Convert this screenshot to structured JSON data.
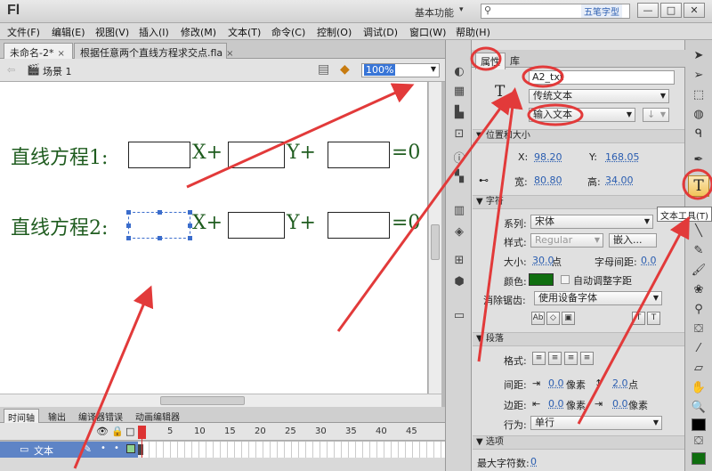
{
  "app": {
    "logo": "Fl",
    "workspace": "基本功能",
    "watermark": "五笔字型"
  },
  "window_controls": {
    "minimize": "—",
    "maximize": "□",
    "close": "✕"
  },
  "menu": [
    "文件(F)",
    "编辑(E)",
    "视图(V)",
    "插入(I)",
    "修改(M)",
    "文本(T)",
    "命令(C)",
    "控制(O)",
    "调试(D)",
    "窗口(W)",
    "帮助(H)"
  ],
  "doc_tabs": [
    "未命名-2*",
    "根据任意两个直线方程求交点.fla"
  ],
  "scene": {
    "label": "场景 1",
    "zoom": "100%"
  },
  "stage": {
    "eq1_label": "直线方程1:",
    "eq2_label": "直线方程2:",
    "x_plus": "X+",
    "y_plus": "Y+",
    "eq_zero": "=0"
  },
  "timeline": {
    "tabs": [
      "时间轴",
      "输出",
      "编译器错误",
      "动画编辑器"
    ],
    "frame_numbers": [
      "1",
      "5",
      "10",
      "15",
      "20",
      "25",
      "30",
      "35",
      "40",
      "45"
    ],
    "layer_name": "文本"
  },
  "properties": {
    "tabs": [
      "属性",
      "库"
    ],
    "instance_name": "A2_txt",
    "text_engine": "传统文本",
    "text_type": "输入文本",
    "section_position": "位置和大小",
    "x_label": "X:",
    "x_value": "98.20",
    "y_label": "Y:",
    "y_value": "168.05",
    "w_label": "宽:",
    "w_value": "80.80",
    "h_label": "高:",
    "h_value": "34.00",
    "section_char": "字符",
    "family_label": "系列:",
    "family_value": "宋体",
    "style_label": "样式:",
    "style_value": "Regular",
    "embed_button": "嵌入...",
    "size_label": "大小:",
    "size_value": "30.0",
    "size_unit": "点",
    "spacing_label": "字母间距:",
    "spacing_value": "0.0",
    "color_label": "颜色:",
    "autokern_label": "自动调整字距",
    "antialias_label": "消除锯齿:",
    "antialias_value": "使用设备字体",
    "section_para": "段落",
    "format_label": "格式:",
    "spacing2_label": "间距:",
    "indent_value": "0.0",
    "indent_unit": "像素",
    "line_value": "2.0",
    "line_unit": "点",
    "margin_label": "边距:",
    "margin_left": "0.0",
    "margin_left_unit": "像素",
    "margin_right": "0.0",
    "margin_right_unit": "像素",
    "behavior_label": "行为:",
    "behavior_value": "单行",
    "section_options": "选项",
    "maxchars_label": "最大字符数:",
    "maxchars_value": "0"
  },
  "tools": {
    "tooltip": "文本工具(T)"
  },
  "colors": {
    "text_green": "#1f5c1f",
    "fill_green": "#0f6e0f",
    "annotation_red": "#e23a3a"
  }
}
